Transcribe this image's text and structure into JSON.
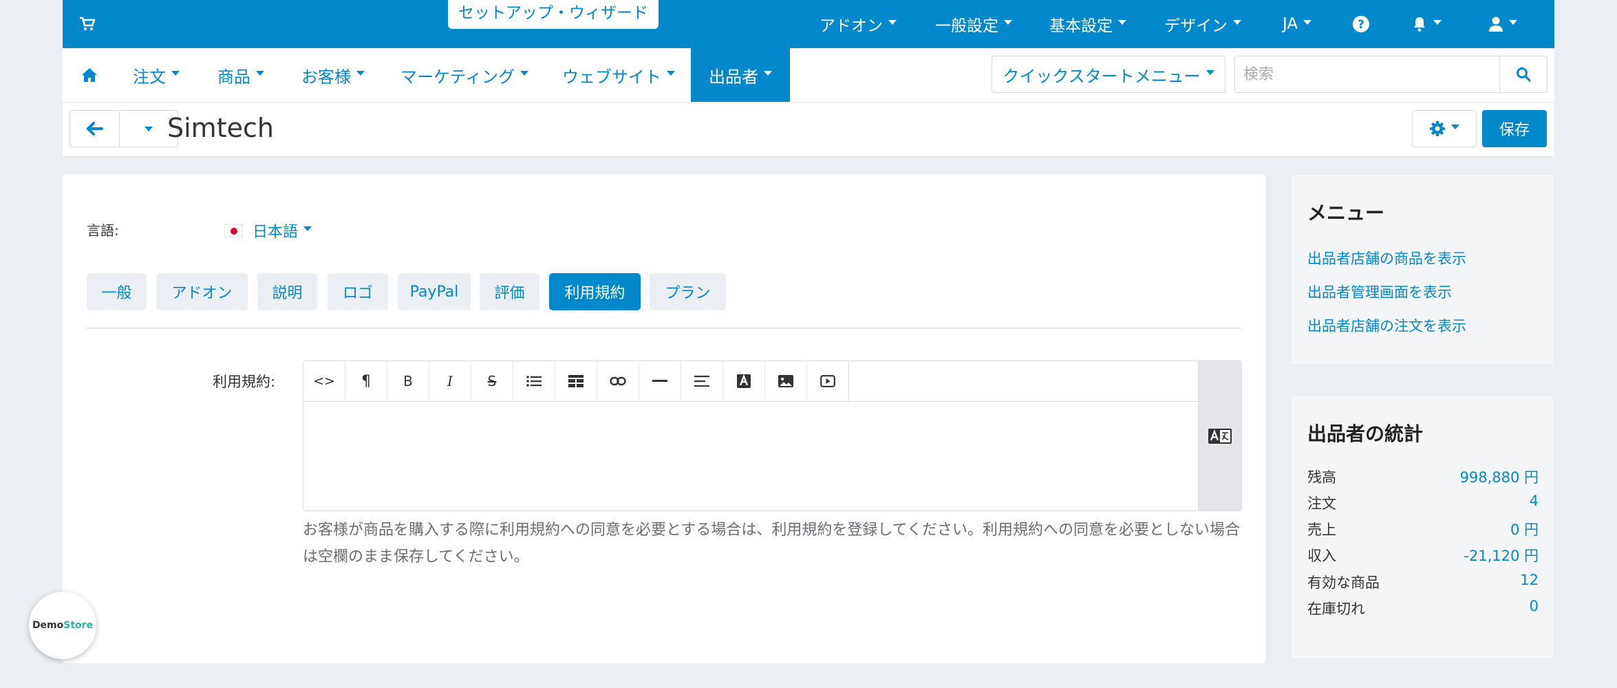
{
  "topbar": {
    "wizard_label": "セットアップ・ウィザード",
    "menus": [
      "アドオン",
      "一般設定",
      "基本設定",
      "デザイン",
      "JA"
    ]
  },
  "nav": {
    "items": [
      "注文",
      "商品",
      "お客様",
      "マーケティング",
      "ウェブサイト",
      "出品者"
    ],
    "quickstart": "クイックスタートメニュー",
    "search_placeholder": "検索"
  },
  "page": {
    "title": "Simtech",
    "save_label": "保存"
  },
  "form": {
    "lang_label": "言語:",
    "lang_value": "日本語",
    "tabs": [
      "一般",
      "アドオン",
      "説明",
      "ロゴ",
      "PayPal",
      "評価",
      "利用規約",
      "プラン"
    ],
    "active_tab": "利用規約",
    "terms_label": "利用規約:",
    "terms_value": "",
    "toolbar_text": {
      "html": "<>",
      "paragraph": "¶",
      "bold": "B",
      "italic": "I",
      "strike": "S"
    },
    "help_text": "お客様が商品を購入する際に利用規約への同意を必要とする場合は、利用規約を登録してください。利用規約への同意を必要としない場合は空欄のまま保存してください。"
  },
  "demo_badge": {
    "part1": "Demo",
    "part2": "Store"
  },
  "sidebar": {
    "menu_title": "メニュー",
    "menu_links": [
      "出品者店舗の商品を表示",
      "出品者管理画面を表示",
      "出品者店舗の注文を表示"
    ],
    "stats_title": "出品者の統計",
    "stats": [
      {
        "label": "残高",
        "value": "998,880 円"
      },
      {
        "label": "注文",
        "value": "4"
      },
      {
        "label": "売上",
        "value": "0 円"
      },
      {
        "label": "収入",
        "value": "-21,120 円"
      },
      {
        "label": "有効な商品",
        "value": "12"
      },
      {
        "label": "在庫切れ",
        "value": "0"
      }
    ]
  },
  "colors": {
    "primary": "#0388cc",
    "background": "#ebeef2",
    "demo_accent": "#2bb5a6"
  }
}
